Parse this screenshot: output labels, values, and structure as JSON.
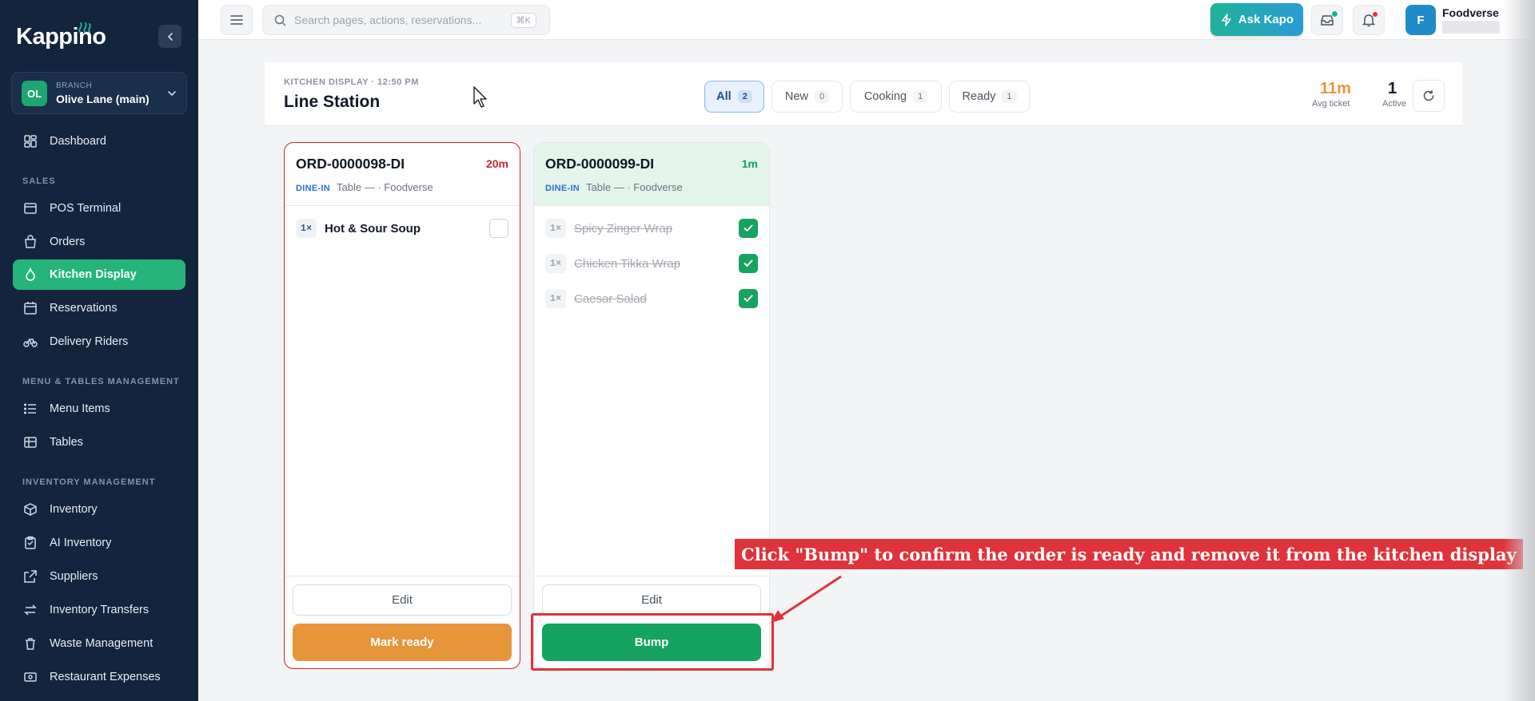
{
  "app": {
    "logo": "Kappino"
  },
  "branch": {
    "initials": "OL",
    "caption": "BRANCH",
    "name": "Olive Lane (main)"
  },
  "nav": {
    "dashboard": "Dashboard",
    "sales_header": "SALES",
    "pos": "POS Terminal",
    "orders": "Orders",
    "kitchen": "Kitchen Display",
    "reservations": "Reservations",
    "riders": "Delivery Riders",
    "menu_header": "MENU & TABLES MANAGEMENT",
    "menu_items": "Menu Items",
    "tables": "Tables",
    "inventory_header": "INVENTORY MANAGEMENT",
    "inventory": "Inventory",
    "ai_inventory": "AI Inventory",
    "suppliers": "Suppliers",
    "transfers": "Inventory Transfers",
    "waste": "Waste Management",
    "expenses": "Restaurant Expenses"
  },
  "topbar": {
    "search_placeholder": "Search pages, actions, reservations...",
    "search_shortcut": "⌘K",
    "ask_label": "Ask Kapo",
    "user_initial": "F",
    "user_name": "Foodverse"
  },
  "kds": {
    "caption": "KITCHEN DISPLAY · 12:50 PM",
    "title": "Line Station",
    "filters": [
      {
        "label": "All",
        "count": "2",
        "active": true
      },
      {
        "label": "New",
        "count": "0"
      },
      {
        "label": "Cooking",
        "count": "1"
      },
      {
        "label": "Ready",
        "count": "1"
      }
    ],
    "avg_ticket_value": "11m",
    "avg_ticket_label": "Avg ticket",
    "active_value": "1",
    "active_label": "Active"
  },
  "tickets": [
    {
      "id": "ORD-0000098-DI",
      "elapsed": "20m",
      "elapsed_color": "#d0262d",
      "type": "DINE-IN",
      "meta": "Table — · Foodverse",
      "items": [
        {
          "qty": "1×",
          "name": "Hot & Sour Soup",
          "done": false
        }
      ],
      "edit_label": "Edit",
      "action_label": "Mark ready",
      "action_color": "#e7953a"
    },
    {
      "id": "ORD-0000099-DI",
      "elapsed": "1m",
      "elapsed_color": "#16a35f",
      "type": "DINE-IN",
      "meta": "Table — · Foodverse",
      "items": [
        {
          "qty": "1×",
          "name": "Spicy Zinger Wrap",
          "done": true
        },
        {
          "qty": "1×",
          "name": "Chicken Tikka Wrap",
          "done": true
        },
        {
          "qty": "1×",
          "name": "Caesar Salad",
          "done": true
        }
      ],
      "edit_label": "Edit",
      "action_label": "Bump",
      "action_color": "#16a35f"
    }
  ],
  "annotation": {
    "text": "Click \"Bump\" to confirm the order is ready and remove it from the kitchen display",
    "color": "#e0323a"
  }
}
